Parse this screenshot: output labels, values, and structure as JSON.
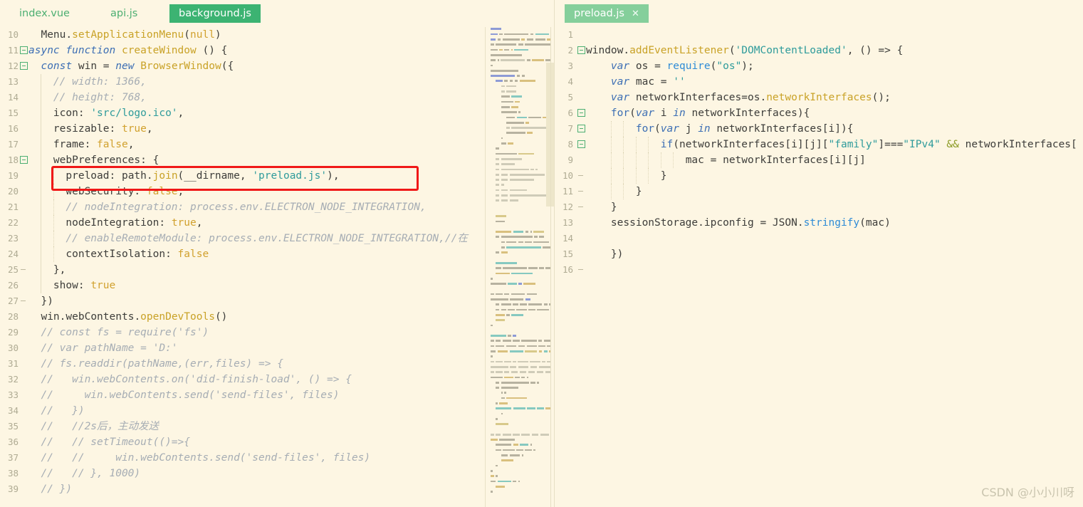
{
  "editor": {
    "theme_background": "#FDF6E3",
    "accent_green": "#3CB372",
    "highlight_box_color": "#F01818"
  },
  "left_pane": {
    "tabs": [
      {
        "label": "index.vue",
        "state": "inactive",
        "closable": false
      },
      {
        "label": "api.js",
        "state": "inactive",
        "closable": false
      },
      {
        "label": "background.js",
        "state": "active",
        "closable": false
      }
    ],
    "first_line_number": 10,
    "lines": [
      {
        "n": 10,
        "fold": "none",
        "text": "  Menu.setApplicationMenu(null)"
      },
      {
        "n": 11,
        "fold": "box",
        "text": "async function createWindow () {"
      },
      {
        "n": 12,
        "fold": "box",
        "text": "  const win = new BrowserWindow({"
      },
      {
        "n": 13,
        "fold": "none",
        "text": "    // width: 1366,"
      },
      {
        "n": 14,
        "fold": "none",
        "text": "    // height: 768,"
      },
      {
        "n": 15,
        "fold": "none",
        "text": "    icon: 'src/logo.ico',"
      },
      {
        "n": 16,
        "fold": "none",
        "text": "    resizable: true,"
      },
      {
        "n": 17,
        "fold": "none",
        "text": "    frame: false,"
      },
      {
        "n": 18,
        "fold": "box",
        "text": "    webPreferences: {"
      },
      {
        "n": 19,
        "fold": "none",
        "text": "      preload: path.join(__dirname, 'preload.js'),"
      },
      {
        "n": 20,
        "fold": "none",
        "text": "      webSecurity: false,"
      },
      {
        "n": 21,
        "fold": "none",
        "text": "      // nodeIntegration: process.env.ELECTRON_NODE_INTEGRATION,"
      },
      {
        "n": 22,
        "fold": "none",
        "text": "      nodeIntegration: true,"
      },
      {
        "n": 23,
        "fold": "none",
        "text": "      // enableRemoteModule: process.env.ELECTRON_NODE_INTEGRATION,//在"
      },
      {
        "n": 24,
        "fold": "none",
        "text": "      contextIsolation: false"
      },
      {
        "n": 25,
        "fold": "dash",
        "text": "    },"
      },
      {
        "n": 26,
        "fold": "none",
        "text": "    show: true"
      },
      {
        "n": 27,
        "fold": "dash",
        "text": "  })"
      },
      {
        "n": 28,
        "fold": "none",
        "text": "  win.webContents.openDevTools()"
      },
      {
        "n": 29,
        "fold": "none",
        "text": "  // const fs = require('fs')"
      },
      {
        "n": 30,
        "fold": "none",
        "text": "  // var pathName = 'D:'"
      },
      {
        "n": 31,
        "fold": "none",
        "text": "  // fs.readdir(pathName,(err,files) => {"
      },
      {
        "n": 32,
        "fold": "none",
        "text": "  //   win.webContents.on('did-finish-load', () => {"
      },
      {
        "n": 33,
        "fold": "none",
        "text": "  //     win.webContents.send('send-files', files)"
      },
      {
        "n": 34,
        "fold": "none",
        "text": "  //   })"
      },
      {
        "n": 35,
        "fold": "none",
        "text": "  //   //2s后，主动发送"
      },
      {
        "n": 36,
        "fold": "none",
        "text": "  //   // setTimeout(()=>{"
      },
      {
        "n": 37,
        "fold": "none",
        "text": "  //   //     win.webContents.send('send-files', files)"
      },
      {
        "n": 38,
        "fold": "none",
        "text": "  //   // }, 1000)"
      },
      {
        "n": 39,
        "fold": "none",
        "text": "  // })"
      }
    ],
    "highlighted_line": 19,
    "highlighted_text": "preload: path.join(__dirname, 'preload.js'),"
  },
  "right_pane": {
    "tabs": [
      {
        "label": "preload.js",
        "state": "semi-active",
        "closable": true,
        "close_glyph": "✕"
      }
    ],
    "lines": [
      {
        "n": 1,
        "fold": "none",
        "text": ""
      },
      {
        "n": 2,
        "fold": "box",
        "text": "window.addEventListener('DOMContentLoaded', () => {"
      },
      {
        "n": 3,
        "fold": "none",
        "text": "    var os = require(\"os\");"
      },
      {
        "n": 4,
        "fold": "none",
        "text": "    var mac = ''"
      },
      {
        "n": 5,
        "fold": "none",
        "text": "    var networkInterfaces=os.networkInterfaces();"
      },
      {
        "n": 6,
        "fold": "box",
        "text": "    for(var i in networkInterfaces){"
      },
      {
        "n": 7,
        "fold": "box",
        "text": "        for(var j in networkInterfaces[i]){"
      },
      {
        "n": 8,
        "fold": "box",
        "text": "            if(networkInterfaces[i][j][\"family\"]===\"IPv4\" && networkInterfaces["
      },
      {
        "n": 9,
        "fold": "none",
        "text": "                mac = networkInterfaces[i][j]"
      },
      {
        "n": 10,
        "fold": "dash",
        "text": "            }"
      },
      {
        "n": 11,
        "fold": "dash",
        "text": "        }"
      },
      {
        "n": 12,
        "fold": "dash",
        "text": "    }"
      },
      {
        "n": 13,
        "fold": "none",
        "text": "    sessionStorage.ipconfig = JSON.stringify(mac)"
      },
      {
        "n": 14,
        "fold": "none",
        "text": ""
      },
      {
        "n": 15,
        "fold": "none",
        "text": "    })"
      },
      {
        "n": 16,
        "fold": "dash",
        "text": ""
      }
    ]
  },
  "watermark": {
    "text": "CSDN @小小川呀"
  }
}
